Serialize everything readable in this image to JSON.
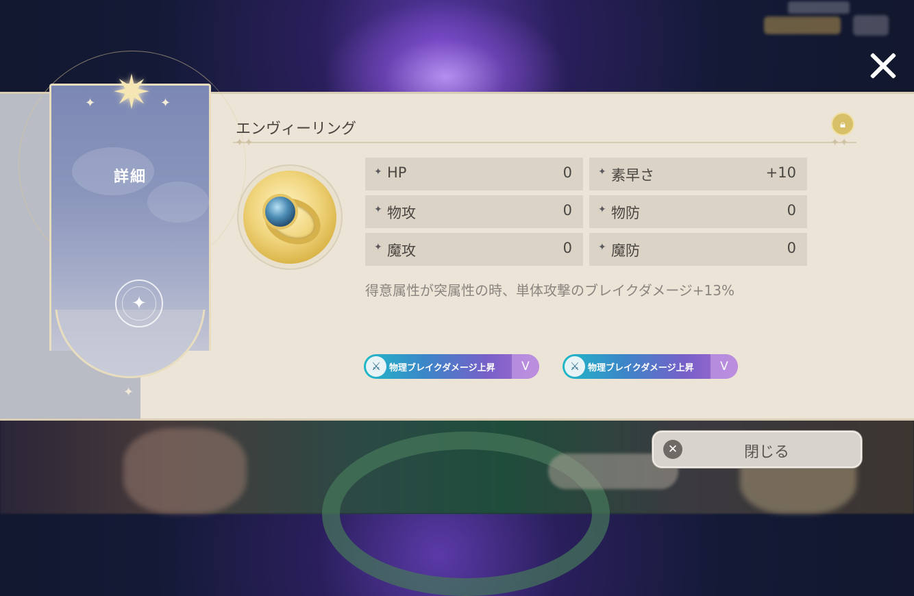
{
  "item": {
    "name": "エンヴィーリング",
    "lock_icon": "lock-icon"
  },
  "banner": {
    "title": "詳細"
  },
  "stats": [
    {
      "label": "HP",
      "value": "0"
    },
    {
      "label": "素早さ",
      "value": "+10"
    },
    {
      "label": "物攻",
      "value": "0"
    },
    {
      "label": "物防",
      "value": "0"
    },
    {
      "label": "魔攻",
      "value": "0"
    },
    {
      "label": "魔防",
      "value": "0"
    }
  ],
  "description": "得意属性が突属性の時、単体攻撃のブレイクダメージ+13%",
  "tags": [
    {
      "text": "物理ブレイクダメージ上昇",
      "level": "V"
    },
    {
      "text": "物理ブレイクダメージ上昇",
      "level": "V"
    }
  ],
  "buttons": {
    "close_label": "閉じる"
  },
  "colors": {
    "panel": "#ece4d6",
    "banner": "#8a95bc",
    "tag_gradient_start": "#1fb8c8",
    "tag_gradient_end": "#a86cd0"
  }
}
